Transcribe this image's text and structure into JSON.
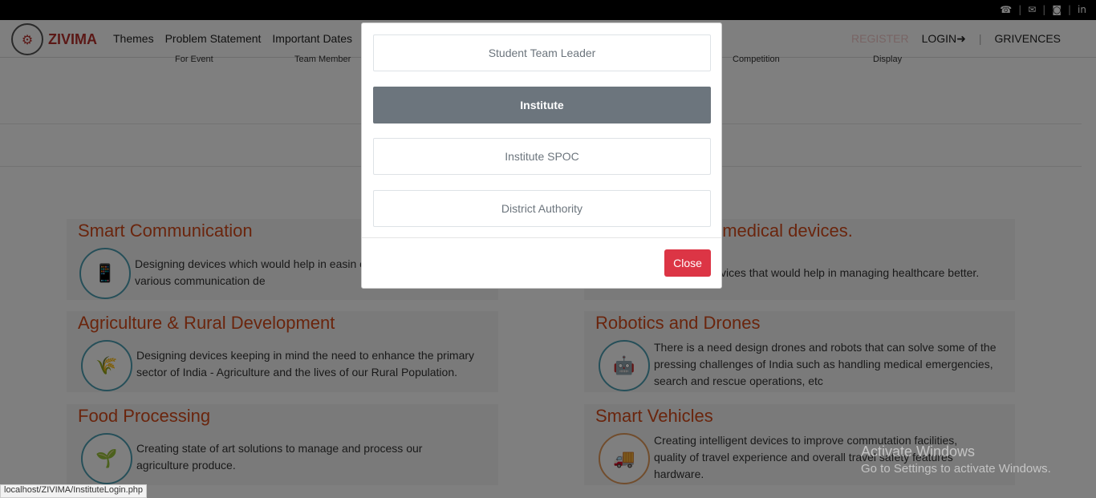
{
  "topbar": {
    "icons": [
      "fax-icon",
      "mail-icon",
      "instagram-icon",
      "linkedin-icon"
    ],
    "glyphs": [
      "☎",
      "✉",
      "◙",
      "in"
    ]
  },
  "brand": {
    "name": "ZIVIMA"
  },
  "nav": {
    "items": [
      "Themes",
      "Problem Statement",
      "Important Dates"
    ],
    "register": "REGISTER",
    "login": "LOGIN",
    "grievences": "GRIVENCES",
    "sub": [
      "For Event",
      "Team Member",
      "Competition",
      "Display"
    ]
  },
  "cards": [
    {
      "title": "Smart Communication",
      "desc": "Designing devices which would help in easin chennels between various communication de",
      "icon": "📱"
    },
    {
      "title": "omedical devices.",
      "desc": "vices that would help in managing healthcare better.",
      "icon": ""
    },
    {
      "title": "Agriculture & Rural Development",
      "desc": "Designing devices keeping in mind the need to enhance the primary sector of India - Agriculture and the lives of our Rural Population.",
      "icon": "🌾"
    },
    {
      "title": "Robotics and Drones",
      "desc": "There is a need design drones and robots that can solve some of the pressing challenges of India such as handling medical emergencies, search and rescue operations, etc",
      "icon": "🤖"
    },
    {
      "title": "Food Processing",
      "desc": "Creating state of art solutions to manage and process our agriculture produce.",
      "icon": "🌱"
    },
    {
      "title": "Smart Vehicles",
      "desc": "Creating intelligent devices to improve commutation facilities, quality of travel experience and overall travel safety features hardware.",
      "icon": "🚚"
    }
  ],
  "modal": {
    "options": [
      "Student Team Leader",
      "Institute",
      "Institute SPOC",
      "District Authority"
    ],
    "active_index": 1,
    "close": "Close"
  },
  "status_url": "localhost/ZIVIMA/InstituteLogin.php",
  "watermark": {
    "line1": "Activate Windows",
    "line2": "Go to Settings to activate Windows."
  },
  "colors": {
    "accent": "#d44a1a",
    "close": "#dc3545",
    "active_option": "#6c757d"
  }
}
